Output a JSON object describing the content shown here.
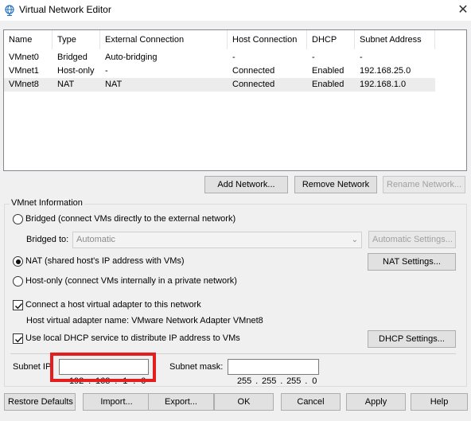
{
  "window": {
    "title": "Virtual Network Editor",
    "close_glyph": "✕",
    "icon": "network-globe-icon"
  },
  "list": {
    "columns": [
      "Name",
      "Type",
      "External Connection",
      "Host Connection",
      "DHCP",
      "Subnet Address"
    ],
    "rows": [
      [
        "VMnet0",
        "Bridged",
        "Auto-bridging",
        "-",
        "-",
        "-"
      ],
      [
        "VMnet1",
        "Host-only",
        "-",
        "Connected",
        "Enabled",
        "192.168.25.0"
      ],
      [
        "VMnet8",
        "NAT",
        "NAT",
        "Connected",
        "Enabled",
        "192.168.1.0"
      ]
    ],
    "selected_row": 2
  },
  "list_buttons": {
    "add": "Add Network...",
    "remove": "Remove Network",
    "rename": "Rename Network..."
  },
  "vmnet_info": {
    "legend": "VMnet Information",
    "bridged_label": "Bridged (connect VMs directly to the external network)",
    "bridged_to_label": "Bridged to:",
    "bridged_to_value": "Automatic",
    "auto_settings": "Automatic Settings...",
    "nat_label": "NAT (shared host's IP address with VMs)",
    "nat_settings": "NAT Settings...",
    "hostonly_label": "Host-only (connect VMs internally in a private network)",
    "connect_adapter_label": "Connect a host virtual adapter to this network",
    "adapter_name_label": "Host virtual adapter name: VMware Network Adapter VMnet8",
    "dhcp_label": "Use local DHCP service to distribute IP address to VMs",
    "dhcp_settings": "DHCP Settings...",
    "subnet_ip_label": "Subnet IP",
    "subnet_ip": [
      "192",
      "168",
      "1",
      "0"
    ],
    "subnet_mask_label": "Subnet mask:",
    "subnet_mask": [
      "255",
      "255",
      "255",
      "0"
    ],
    "selected_mode": "NAT",
    "connect_adapter_checked": true,
    "dhcp_checked": true
  },
  "bottom_buttons": {
    "restore": "Restore Defaults",
    "import": "Import...",
    "export": "Export...",
    "ok": "OK",
    "cancel": "Cancel",
    "apply": "Apply",
    "help": "Help"
  },
  "colors": {
    "highlight": "#e41e1e",
    "selected_row": "#ececec"
  }
}
